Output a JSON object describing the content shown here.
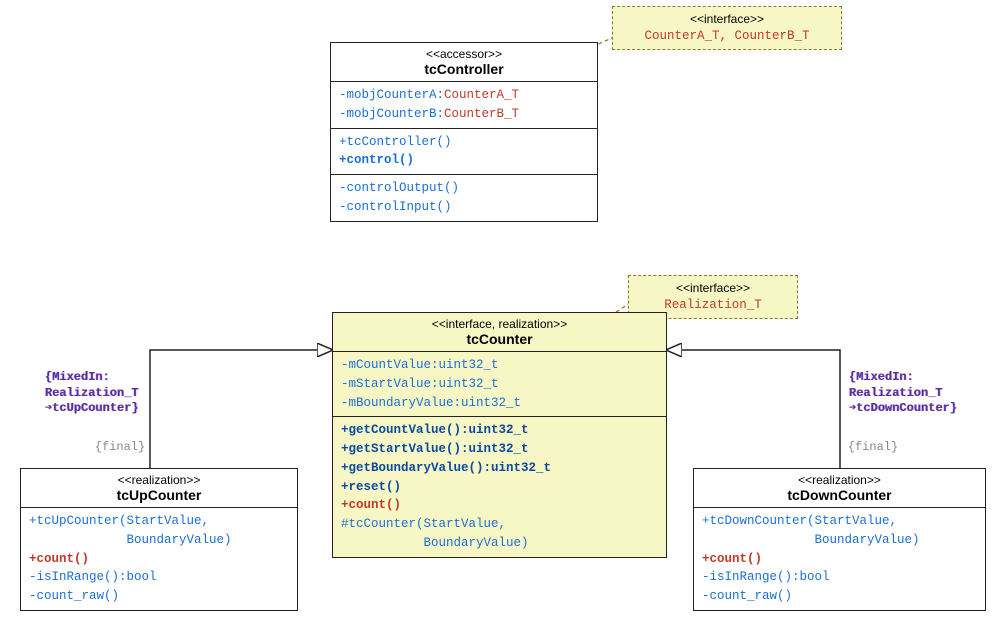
{
  "iface_tag_controller": {
    "stereo": "<<interface>>",
    "names": "CounterA_T, CounterB_T"
  },
  "iface_tag_counter": {
    "stereo": "<<interface>>",
    "names": "Realization_T"
  },
  "controller": {
    "stereo": "<<accessor>>",
    "name": "tcController",
    "attr1_name": "-mobjCounterA:",
    "attr1_type": "CounterA_T",
    "attr2_name": "-mobjCounterB:",
    "attr2_type": "CounterB_T",
    "op1": "+tcController()",
    "op2": "+control()",
    "op3": "-controlOutput()",
    "op4": "-controlInput()"
  },
  "counter": {
    "stereo": "<<interface, realization>>",
    "name": "tcCounter",
    "a1": "-mCountValue:uint32_t",
    "a2": "-mStartValue:uint32_t",
    "a3": "-mBoundaryValue:uint32_t",
    "m1": "+getCountValue():uint32_t",
    "m2": "+getStartValue():uint32_t",
    "m3": "+getBoundaryValue():uint32_t",
    "m4": "+reset()",
    "m5": "+count()",
    "m6a": "#tcCounter(StartValue,",
    "m6b": "           BoundaryValue)"
  },
  "upcounter": {
    "stereo": "<<realization>>",
    "name": "tcUpCounter",
    "m1a": "+tcUpCounter(StartValue,",
    "m1b": "             BoundaryValue)",
    "m2": "+count()",
    "m3": "-isInRange():bool",
    "m4": "-count_raw()"
  },
  "downcounter": {
    "stereo": "<<realization>>",
    "name": "tcDownCounter",
    "m1a": "+tcDownCounter(StartValue,",
    "m1b": "               BoundaryValue)",
    "m2": "+count()",
    "m3": "-isInRange():bool",
    "m4": "-count_raw()"
  },
  "mixin_left": "{MixedIn:\nRealization_T\n➔tcUpCounter}",
  "mixin_right": "{MixedIn:\nRealization_T\n➔tcDownCounter}",
  "final": "{final}"
}
